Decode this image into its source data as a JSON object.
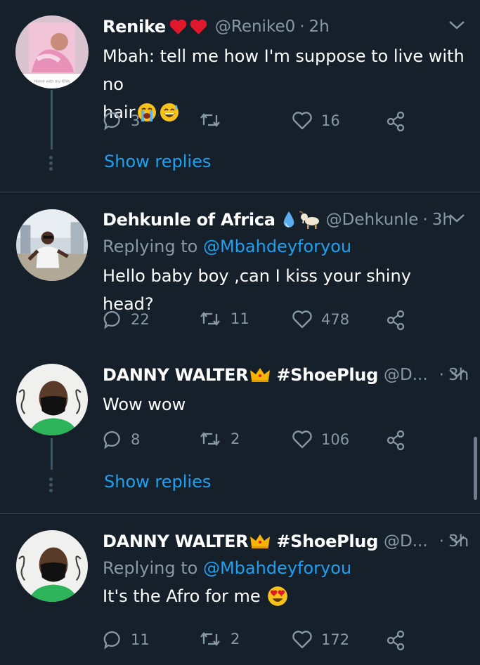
{
  "colors": {
    "background": "#15202b",
    "text": "#ffffff",
    "muted": "#8899a6",
    "accent": "#1da1f2",
    "divider": "#38444d",
    "thread_line": "#3d5466"
  },
  "tweets": [
    {
      "name": "Renike",
      "name_emojis": [
        "red-heart",
        "red-heart"
      ],
      "handle": "@Renike0",
      "sep": "·",
      "time": "2h",
      "text_line1": "Mbah: tell me how I'm suppose to live with no",
      "text_line2": "hair",
      "text_emojis": [
        "loudly-crying-face",
        "grinning-sweat-face"
      ],
      "replies": "3",
      "retweets": "",
      "likes": "16",
      "show_replies": "Show replies"
    },
    {
      "name": "Dehkunle of Africa",
      "name_emojis": [
        "droplet",
        "goat"
      ],
      "handle": "@Dehkunle",
      "sep": "·",
      "time": "3h",
      "replying_prefix": "Replying to",
      "replying_to": "@Mbahdeyforyou",
      "text": "Hello baby boy ,can I kiss your shiny head?",
      "replies": "22",
      "retweets": "11",
      "likes": "478"
    },
    {
      "name": "DANNY WALTER",
      "name_emojis": [
        "crown"
      ],
      "name_suffix": "#ShoePlug",
      "handle": "@D...",
      "sep": "·",
      "time": "3h",
      "text": "Wow wow",
      "replies": "8",
      "retweets": "2",
      "likes": "106",
      "show_replies": "Show replies"
    },
    {
      "name": "DANNY WALTER",
      "name_emojis": [
        "crown"
      ],
      "name_suffix": "#ShoePlug",
      "handle": "@D...",
      "sep": "·",
      "time": "3h",
      "replying_prefix": "Replying to",
      "replying_to": "@Mbahdeyforyou",
      "text": "It's the Afro for me",
      "text_emojis": [
        "heart-eyes-face"
      ],
      "replies": "11",
      "retweets": "2",
      "likes": "172"
    }
  ],
  "avatar1_caption": "Home with my lOVe"
}
